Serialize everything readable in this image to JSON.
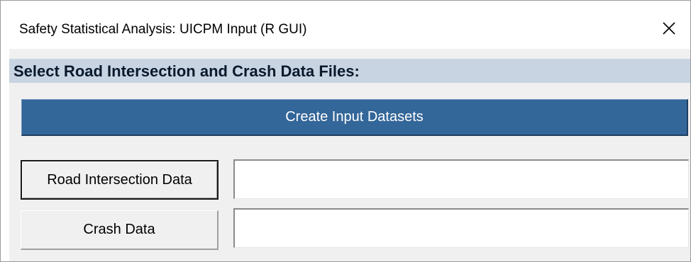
{
  "window": {
    "title": "Safety Statistical Analysis: UICPM Input (R GUI)",
    "close_icon": "close-icon"
  },
  "form": {
    "heading": "Select Road Intersection and Crash Data Files:",
    "create_button_label": "Create Input Datasets",
    "road_button_label": "Road Intersection Data",
    "road_field_value": "",
    "crash_button_label": "Crash Data",
    "crash_field_value": ""
  },
  "colors": {
    "heading_band": "#c8d4e2",
    "create_button": "#336699",
    "form_background": "#f0f0f0"
  }
}
